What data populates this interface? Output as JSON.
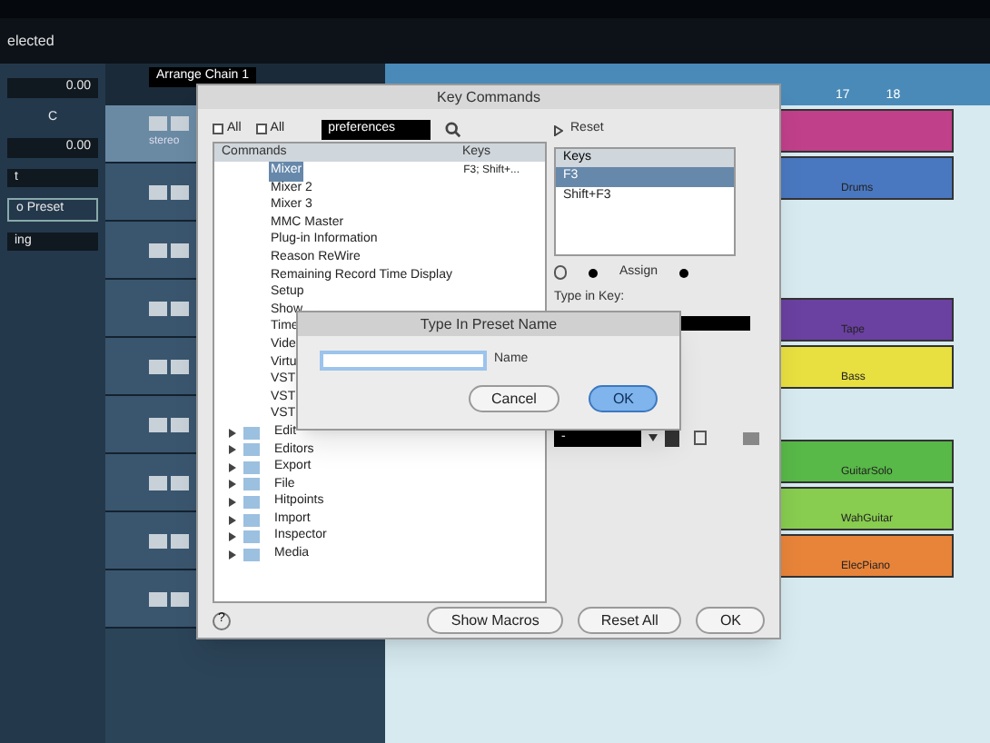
{
  "app": {
    "status": "elected",
    "ruler": [
      "17",
      "18"
    ],
    "inspector": {
      "values": [
        {
          "kind": "value",
          "text": "0.00"
        },
        {
          "kind": "pan",
          "text": "C"
        },
        {
          "kind": "value",
          "text": "0.00"
        },
        {
          "kind": "name",
          "text": "t"
        },
        {
          "kind": "preset",
          "text": "o Preset"
        },
        {
          "kind": "name",
          "text": "ing"
        }
      ]
    },
    "tracks": {
      "chain": "Arrange Chain 1",
      "rows": [
        {
          "label": "stereo",
          "selected": true
        },
        {
          "label": "",
          "selected": false
        },
        {
          "label": "",
          "selected": false
        },
        {
          "label": "",
          "selected": false
        },
        {
          "label": "",
          "selected": false
        },
        {
          "label": "",
          "selected": false
        },
        {
          "label": "",
          "selected": false
        },
        {
          "label": "",
          "selected": false
        },
        {
          "label": "",
          "selected": false
        }
      ]
    },
    "parts": [
      {
        "color": "#c0408a"
      },
      {
        "name": "Drums",
        "color": "#4a78c0"
      },
      {
        "name": "Tape",
        "color": "#6a40a0"
      },
      {
        "name": "Bass",
        "color": "#e8e040"
      },
      {
        "name": "GuitarSolo",
        "color": "#58b848"
      },
      {
        "name": "WahGuitar",
        "color": "#88cc50"
      },
      {
        "name": "ElecPiano",
        "color": "#e8843a"
      }
    ]
  },
  "dialog": {
    "title": "Key Commands",
    "filters": [
      {
        "label": "All",
        "checked": false
      },
      {
        "label": "All",
        "checked": false
      }
    ],
    "search": "preferences",
    "columns": [
      "Commands",
      "Keys"
    ],
    "commands": [
      {
        "kind": "command",
        "name": "Mixer",
        "keys": "F3; Shift+...",
        "selected": true
      },
      {
        "kind": "command",
        "name": "Mixer 2",
        "selected": false
      },
      {
        "kind": "command",
        "name": "Mixer 3",
        "selected": false
      },
      {
        "kind": "command",
        "name": "MMC Master",
        "selected": false
      },
      {
        "kind": "command",
        "name": "Plug-in Information",
        "selected": false
      },
      {
        "kind": "command",
        "name": "Reason ReWire",
        "selected": false
      },
      {
        "kind": "command",
        "name": "Remaining Record Time Display",
        "selected": false
      },
      {
        "kind": "command",
        "name": "Setup",
        "selected": false
      },
      {
        "kind": "command",
        "name": "Show",
        "selected": false
      },
      {
        "kind": "command",
        "name": "Time",
        "selected": false
      },
      {
        "kind": "command",
        "name": "Vide",
        "selected": false
      },
      {
        "kind": "command",
        "name": "Virtu",
        "selected": false
      },
      {
        "kind": "command",
        "name": "VST",
        "selected": false
      },
      {
        "kind": "command",
        "name": "VST",
        "selected": false
      },
      {
        "kind": "command",
        "name": "VST",
        "selected": false
      },
      {
        "kind": "folder",
        "name": "Edit",
        "selected": false
      },
      {
        "kind": "folder",
        "name": "Editors",
        "selected": false
      },
      {
        "kind": "folder",
        "name": "Export",
        "selected": false
      },
      {
        "kind": "folder",
        "name": "File",
        "selected": false
      },
      {
        "kind": "folder",
        "name": "Hitpoints",
        "selected": false
      },
      {
        "kind": "folder",
        "name": "Import",
        "selected": false
      },
      {
        "kind": "folder",
        "name": "Inspector",
        "selected": false
      },
      {
        "kind": "folder",
        "name": "Media",
        "selected": false
      }
    ],
    "reset": "Reset",
    "keys_header": "Keys",
    "keys": [
      {
        "key": "F3",
        "selected": true
      },
      {
        "key": "Shift+F3",
        "selected": false
      }
    ],
    "assign": "Assign",
    "type_in_key": "Type in Key:",
    "preset": "-",
    "help": "?",
    "buttons": [
      "Show Macros",
      "Reset All",
      "OK"
    ]
  },
  "sheet": {
    "title": "Type In Preset Name",
    "field": {
      "label": "Name"
    },
    "buttons": [
      {
        "label": "Cancel",
        "default": false
      },
      {
        "label": "OK",
        "default": true
      }
    ]
  }
}
